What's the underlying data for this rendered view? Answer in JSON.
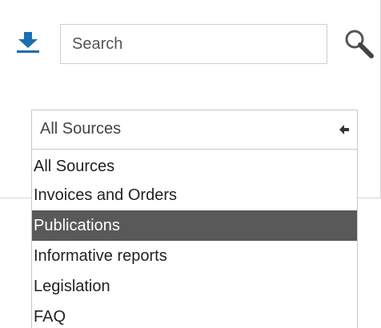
{
  "search": {
    "placeholder": "Search",
    "value": ""
  },
  "icons": {
    "download": "download-icon",
    "search": "magnifier-icon",
    "select_arrow": "arrow-left-icon"
  },
  "colors": {
    "accent": "#1a6fb5",
    "highlight_bg": "#595959",
    "highlight_text": "#ffffff"
  },
  "source_select": {
    "selected_label": "All Sources",
    "options": [
      {
        "label": "All Sources"
      },
      {
        "label": "Invoices and Orders"
      },
      {
        "label": "Publications",
        "highlighted": true
      },
      {
        "label": "Informative reports"
      },
      {
        "label": "Legislation"
      },
      {
        "label": "FAQ"
      }
    ]
  }
}
